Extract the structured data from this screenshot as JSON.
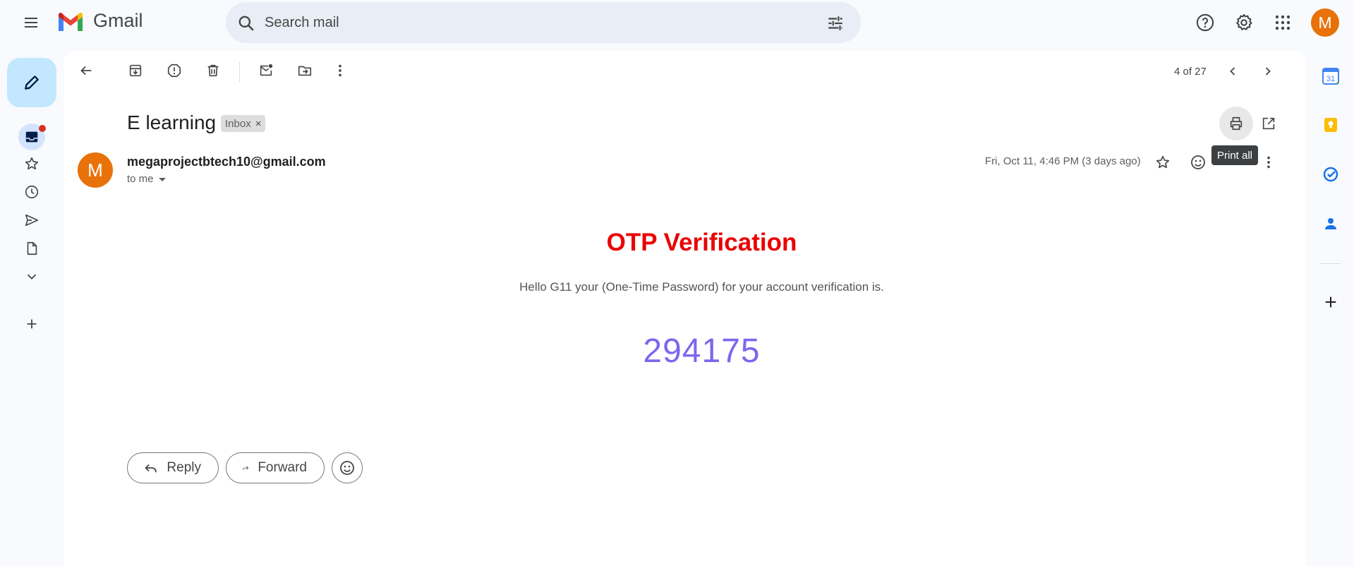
{
  "app": {
    "name": "Gmail",
    "menu_icon": "hamburger-menu-icon",
    "avatar_initial": "M"
  },
  "search": {
    "placeholder": "Search mail",
    "icon": "search-icon",
    "options_icon": "tune-icon"
  },
  "header_icons": [
    "help-icon",
    "settings-gear-icon",
    "apps-grid-icon"
  ],
  "sidebar": {
    "compose_icon": "pencil-icon",
    "items": [
      {
        "name": "inbox",
        "icon": "inbox-icon",
        "has_unread_dot": true
      },
      {
        "name": "starred",
        "icon": "star-icon"
      },
      {
        "name": "snoozed",
        "icon": "clock-icon"
      },
      {
        "name": "sent",
        "icon": "send-icon"
      },
      {
        "name": "drafts",
        "icon": "draft-file-icon"
      },
      {
        "name": "more",
        "icon": "chevron-down-icon"
      }
    ],
    "add_label_icon": "plus-icon"
  },
  "toolbar": {
    "icons": [
      "back-arrow-icon",
      "archive-icon",
      "report-spam-icon",
      "delete-icon",
      "mark-unread-icon",
      "move-to-icon",
      "more-vert-icon"
    ],
    "pagination": "4 of 27"
  },
  "message": {
    "subject": "E learning",
    "label": "Inbox",
    "label_remove": "×",
    "sender_initial": "M",
    "sender_email": "megaprojectbtech10@gmail.com",
    "to": "to me",
    "date": "Fri, Oct 11, 4:46 PM (3 days ago)",
    "tooltip": "Print all",
    "accent_color": "#e8710a"
  },
  "body": {
    "title": "OTP Verification",
    "text": "Hello G11 your (One-Time Password) for your account verification is.",
    "code": "294175",
    "title_color": "#ea0000",
    "code_color": "#7b68ee"
  },
  "actions": {
    "reply": "Reply",
    "forward": "Forward"
  },
  "side_panel": {
    "calendar_date": "31",
    "apps": [
      "calendar-icon",
      "keep-icon",
      "tasks-icon",
      "contacts-icon"
    ],
    "add_icon": "plus-icon"
  }
}
